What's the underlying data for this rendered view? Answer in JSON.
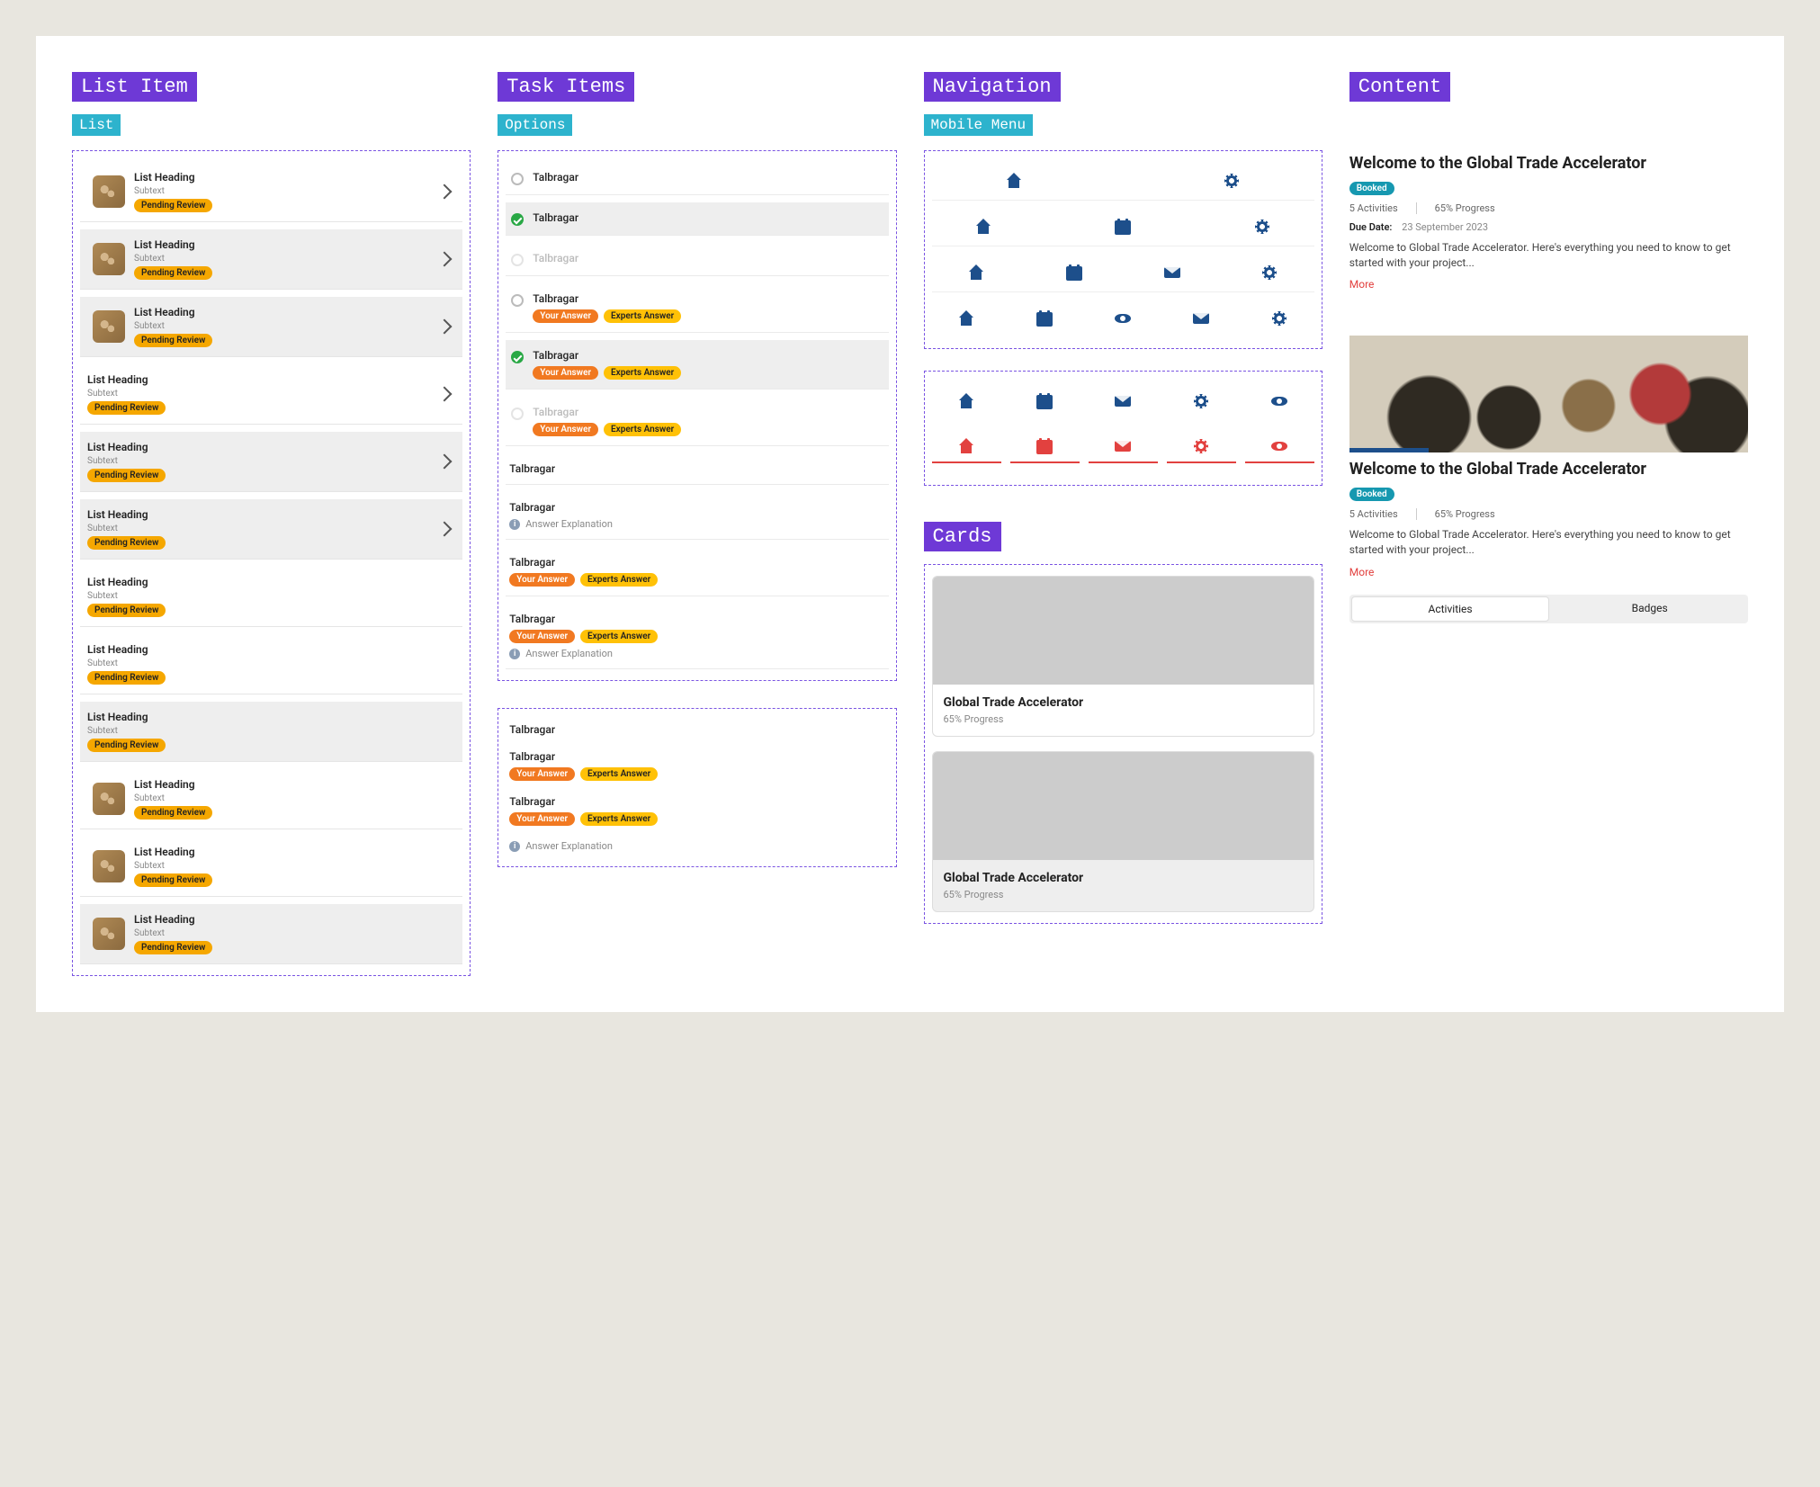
{
  "sections": {
    "list_item": "List Item",
    "task_items": "Task Items",
    "navigation": "Navigation",
    "content": "Content",
    "cards": "Cards"
  },
  "subsections": {
    "list": "List",
    "options": "Options",
    "mobile_menu": "Mobile Menu"
  },
  "list": {
    "heading": "List Heading",
    "subtext": "Subtext",
    "badge": "Pending Review"
  },
  "task": {
    "title": "Talbragar",
    "your_answer": "Your Answer",
    "experts_answer": "Experts Answer",
    "explanation": "Answer Explanation"
  },
  "card": {
    "title": "Global Trade Accelerator",
    "progress": "65% Progress"
  },
  "content": {
    "title": "Welcome to the Global Trade Accelerator",
    "booked": "Booked",
    "activities": "5 Activities",
    "progress": "65% Progress",
    "due_label": "Due Date:",
    "due_date": "23 September 2023",
    "desc": "Welcome to Global Trade Accelerator. Here's everything you need to know to get started with your project...",
    "more": "More"
  },
  "seg": {
    "activities": "Activities",
    "badges": "Badges"
  }
}
